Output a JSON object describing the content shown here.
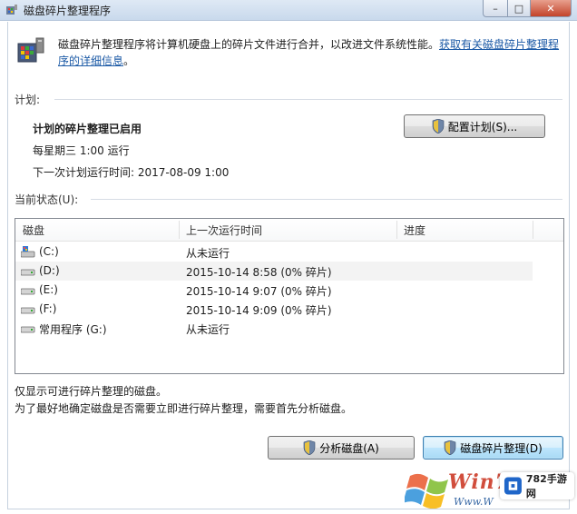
{
  "window": {
    "title": "磁盘碎片整理程序",
    "close_glyph": "✕",
    "max_glyph": "□",
    "min_glyph": "–"
  },
  "intro": {
    "text": "磁盘碎片整理程序将计算机硬盘上的碎片文件进行合并，以改进文件系统性能。",
    "link": "获取有关磁盘碎片整理程序的详细信息",
    "end": "。"
  },
  "schedule": {
    "label": "计划:",
    "status": "计划的碎片整理已启用",
    "frequency": "每星期三  1:00 运行",
    "next_run": "下一次计划运行时间: 2017-08-09 1:00",
    "configure_button": "配置计划(S)..."
  },
  "current": {
    "label": "当前状态(U):",
    "columns": [
      "磁盘",
      "上一次运行时间",
      "进度"
    ],
    "rows": [
      {
        "disk": "(C:)",
        "last_run": "从未运行",
        "progress": ""
      },
      {
        "disk": "(D:)",
        "last_run": "2015-10-14 8:58 (0% 碎片)",
        "progress": ""
      },
      {
        "disk": "(E:)",
        "last_run": "2015-10-14 9:07 (0% 碎片)",
        "progress": ""
      },
      {
        "disk": "(F:)",
        "last_run": "2015-10-14 9:09 (0% 碎片)",
        "progress": ""
      },
      {
        "disk": "常用程序 (G:)",
        "last_run": "从未运行",
        "progress": ""
      }
    ]
  },
  "notes": {
    "line1": "仅显示可进行碎片整理的磁盘。",
    "line2": "为了最好地确定磁盘是否需要立即进行碎片整理，需要首先分析磁盘。"
  },
  "actions": {
    "analyze": "分析磁盘(A)",
    "defrag": "磁盘碎片整理(D)"
  },
  "watermark": {
    "brand": "Win7",
    "url": "Www.W",
    "badge": "782手游网"
  },
  "colors": {
    "link": "#1c5aa6",
    "accent": "#3c7fb1"
  }
}
